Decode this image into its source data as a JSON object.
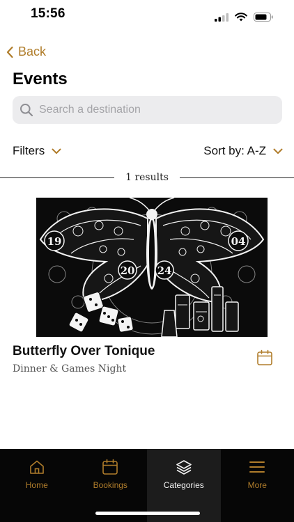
{
  "status_bar": {
    "time": "15:56"
  },
  "nav": {
    "back_label": "Back"
  },
  "page": {
    "title": "Events"
  },
  "search": {
    "placeholder": "Search a destination",
    "value": ""
  },
  "filters": {
    "label": "Filters"
  },
  "sort": {
    "label": "Sort by: A-Z"
  },
  "results": {
    "text": "1 results"
  },
  "events": [
    {
      "title": "Butterfly Over Tonique",
      "subtitle": "Dinner & Games Night",
      "image_text": {
        "left_year": "19",
        "right_year": "04",
        "center_left": "20",
        "center_right": "24"
      }
    }
  ],
  "tab_bar": {
    "items": [
      {
        "label": "Home",
        "icon": "home-icon",
        "active": false
      },
      {
        "label": "Bookings",
        "icon": "calendar-icon",
        "active": false
      },
      {
        "label": "Categories",
        "icon": "layers-icon",
        "active": true
      },
      {
        "label": "More",
        "icon": "menu-icon",
        "active": false
      }
    ]
  },
  "colors": {
    "accent": "#b07d2b",
    "tab_bar_bg": "#060606",
    "tab_active_bg": "#1c1c1c",
    "search_bg": "#ececee"
  }
}
